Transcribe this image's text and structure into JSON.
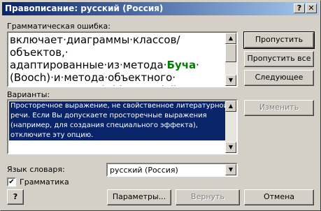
{
  "window": {
    "title": "Правописание: русский (Россия)",
    "help_glyph": "?",
    "close_glyph": "✕"
  },
  "error_label": "Грамматическая ошибка:",
  "error_text": {
    "before": "включает·диаграммы·классов/объектов,· адаптированные·из·метода·",
    "highlight": "Буча",
    "after": "· (Booch)·и·метода·объектного· моделирования·(Object·Modeling· Technique,·OMT)·"
  },
  "buttons": {
    "skip": "Пропустить",
    "skip_all": "Пропустить все",
    "next": "Следующее",
    "change": "Изменить",
    "options": "Параметры...",
    "undo": "Вернуть",
    "cancel": "Отмена"
  },
  "variants_label": "Варианты:",
  "variants_lines": [
    "Просторечное выражение, не свойственное литературной",
    "речи. Если Вы допускаете просторечные выражения",
    "(например, для создания специального эффекта),",
    "отключите эту опцию."
  ],
  "dictionary_label": "Язык словаря:",
  "dictionary_value": "русский (Россия)",
  "grammar_label": "Грамматика",
  "grammar_checked": true,
  "help_button_glyph": "?"
}
